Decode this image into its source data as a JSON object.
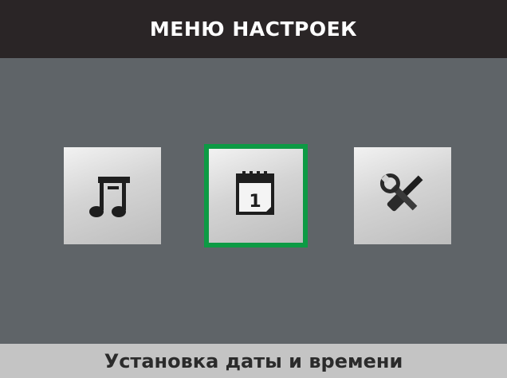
{
  "header": {
    "title": "МЕНЮ НАСТРОЕК"
  },
  "menu": {
    "items": [
      {
        "icon": "music-note-icon",
        "selected": false
      },
      {
        "icon": "calendar-icon",
        "selected": true,
        "calendar_day": "1"
      },
      {
        "icon": "tools-icon",
        "selected": false
      }
    ],
    "selection_color": "#0d9a44"
  },
  "status": {
    "label": "Установка даты и времени"
  }
}
